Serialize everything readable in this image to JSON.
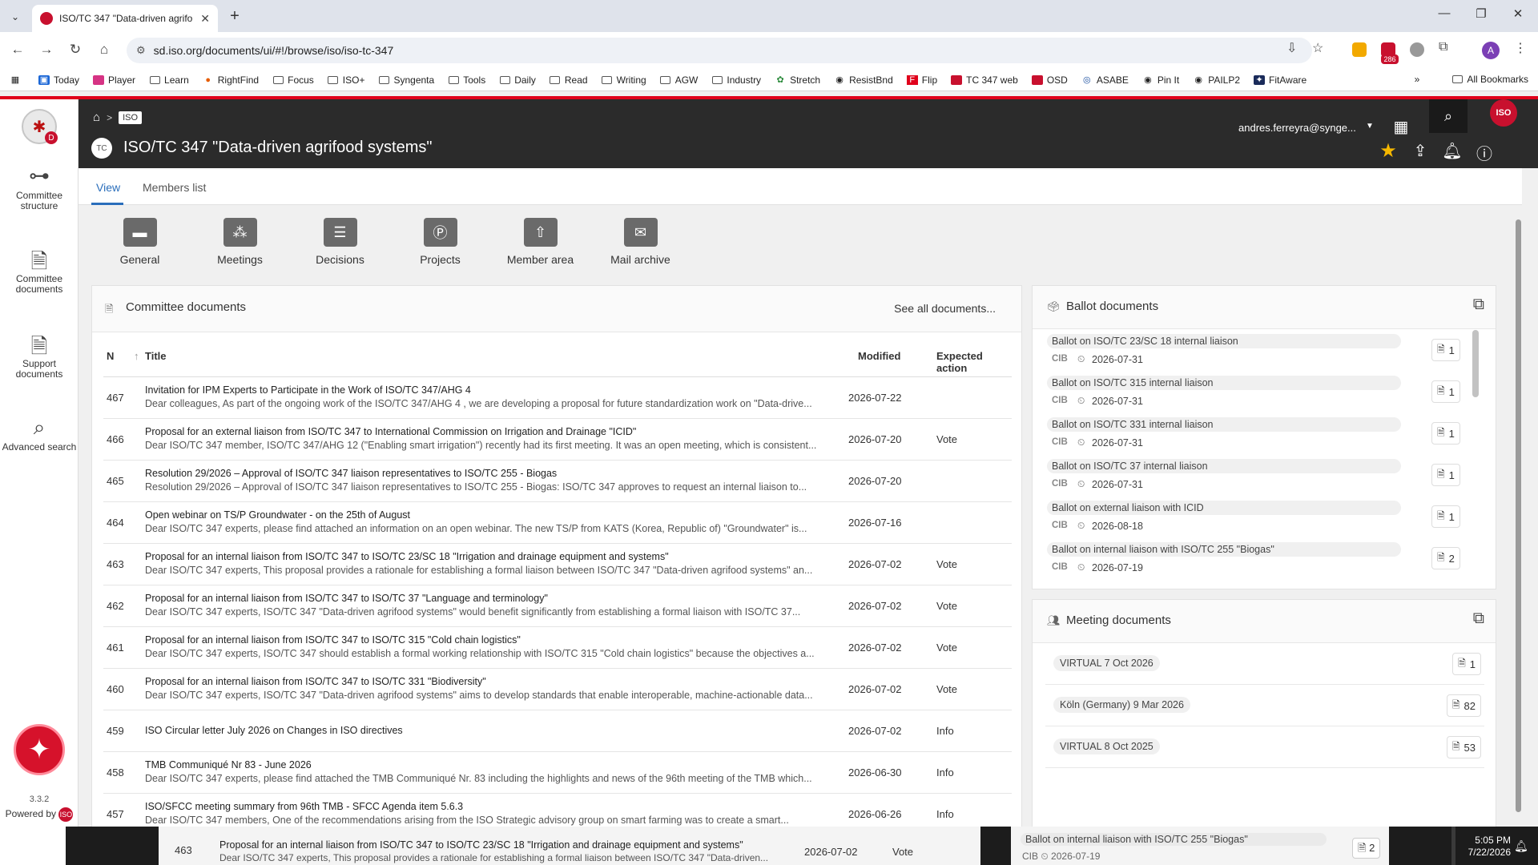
{
  "browser": {
    "tab_title": "ISO/TC 347 \"Data-driven agrifo",
    "url": "sd.iso.org/documents/ui/#!/browse/iso/iso-tc-347",
    "ext_badge": "286",
    "profile_initial": "A",
    "bookmarks": [
      "Today",
      "Player",
      "Learn",
      "RightFind",
      "Focus",
      "ISO+",
      "Syngenta",
      "Tools",
      "Daily",
      "Read",
      "Writing",
      "AGW",
      "Industry",
      "Stretch",
      "ResistBnd",
      "Flip",
      "TC 347 web",
      "OSD",
      "ASABE",
      "Pin It",
      "PAILP2",
      "FitAware"
    ],
    "all_bookmarks": "All Bookmarks"
  },
  "sidebar": {
    "logo_badge": "D",
    "items": [
      {
        "label": "Committee structure",
        "icon": "hierarchy-icon"
      },
      {
        "label": "Committee documents",
        "icon": "document-icon"
      },
      {
        "label": "Support documents",
        "icon": "document-icon"
      },
      {
        "label": "Advanced search",
        "icon": "search-icon"
      }
    ],
    "version": "3.3.2",
    "powered_by": "Powered by",
    "powered_logo": "ISO"
  },
  "header": {
    "breadcrumb_iso": "ISO",
    "tc_badge": "TC",
    "title": "ISO/TC 347 \"Data-driven agrifood systems\"",
    "user": "andres.ferreyra@synge...",
    "iso_logo": "ISO"
  },
  "subnav": {
    "tabs": [
      "View",
      "Members list"
    ],
    "active": "View"
  },
  "quicklinks": [
    "General",
    "Meetings",
    "Decisions",
    "Projects",
    "Member area",
    "Mail archive"
  ],
  "committee_documents": {
    "title": "Committee documents",
    "see_all": "See all documents...",
    "columns": {
      "n": "N",
      "title": "Title",
      "modified": "Modified",
      "action": "Expected action"
    },
    "rows": [
      {
        "n": "467",
        "title": "Invitation for IPM Experts to Participate in the Work of ISO/TC 347/AHG 4",
        "desc": "Dear colleagues, As part of the ongoing work of the ISO/TC 347/AHG 4 , we are developing a proposal for future standardization work on \"Data-drive...",
        "modified": "2026-07-22",
        "action": ""
      },
      {
        "n": "466",
        "title": "Proposal for an external liaison from ISO/TC 347 to International Commission on Irrigation and Drainage \"ICID\"",
        "desc": "Dear ISO/TC 347 member, ISO/TC 347/AHG 12 (\"Enabling smart irrigation\") recently had its first meeting. It was an open meeting, which is consistent...",
        "modified": "2026-07-20",
        "action": "Vote"
      },
      {
        "n": "465",
        "title": "Resolution 29/2026 – Approval of ISO/TC 347 liaison representatives to ISO/TC 255 - Biogas",
        "desc": "Resolution 29/2026 – Approval of ISO/TC 347 liaison representatives to ISO/TC 255 - Biogas: ISO/TC 347 approves to request an internal liaison to...",
        "modified": "2026-07-20",
        "action": ""
      },
      {
        "n": "464",
        "title": "Open webinar on TS/P Groundwater - on the 25th of August",
        "desc": "Dear ISO/TC 347 experts, please find attached an information on an open webinar. The new TS/P from KATS (Korea, Republic of) \"Groundwater\" is...",
        "modified": "2026-07-16",
        "action": ""
      },
      {
        "n": "463",
        "title": "Proposal for an internal liaison from ISO/TC 347 to ISO/TC 23/SC 18 \"Irrigation and drainage equipment and systems\"",
        "desc": "Dear ISO/TC 347 experts, This proposal provides a rationale for establishing a formal liaison between ISO/TC 347 \"Data-driven agrifood systems\" an...",
        "modified": "2026-07-02",
        "action": "Vote"
      },
      {
        "n": "462",
        "title": "Proposal for an internal liaison from ISO/TC 347 to ISO/TC 37 \"Language and terminology\"",
        "desc": "Dear ISO/TC 347 experts, ISO/TC 347 \"Data-driven agrifood systems\" would benefit significantly from establishing a formal liaison with ISO/TC 37...",
        "modified": "2026-07-02",
        "action": "Vote"
      },
      {
        "n": "461",
        "title": "Proposal for an internal liaison from ISO/TC 347 to ISO/TC 315 \"Cold chain logistics\"",
        "desc": "Dear ISO/TC 347 experts, ISO/TC 347 should establish a formal working relationship with ISO/TC 315 \"Cold chain logistics\" because the objectives a...",
        "modified": "2026-07-02",
        "action": "Vote"
      },
      {
        "n": "460",
        "title": "Proposal for an internal liaison from ISO/TC 347 to ISO/TC 331 \"Biodiversity\"",
        "desc": "Dear ISO/TC 347 experts, ISO/TC 347 \"Data-driven agrifood systems\" aims to develop standards that enable interoperable, machine-actionable data...",
        "modified": "2026-07-02",
        "action": "Vote"
      },
      {
        "n": "459",
        "title": "ISO Circular letter July 2026 on Changes in ISO directives",
        "desc": "",
        "modified": "2026-07-02",
        "action": "Info"
      },
      {
        "n": "458",
        "title": "TMB Communiqué Nr 83 - June 2026",
        "desc": "Dear ISO/TC 347 experts, please find attached the TMB Communiqué Nr. 83 including the highlights and news of the 96th meeting of the TMB which...",
        "modified": "2026-06-30",
        "action": "Info"
      },
      {
        "n": "457",
        "title": "ISO/SFCC meeting summary from 96th TMB - SFCC Agenda item 5.6.3",
        "desc": "Dear ISO/TC 347 members, One of the recommendations arising from the ISO Strategic advisory group on smart farming was to create a smart...",
        "modified": "2026-06-26",
        "action": "Info"
      }
    ]
  },
  "ballot_documents": {
    "title": "Ballot documents",
    "items": [
      {
        "title": "Ballot on ISO/TC 23/SC 18 internal liaison",
        "tag": "CIB",
        "date": "2026-07-31",
        "count": "1"
      },
      {
        "title": "Ballot on ISO/TC 315 internal liaison",
        "tag": "CIB",
        "date": "2026-07-31",
        "count": "1"
      },
      {
        "title": "Ballot on ISO/TC 331 internal liaison",
        "tag": "CIB",
        "date": "2026-07-31",
        "count": "1"
      },
      {
        "title": "Ballot on ISO/TC 37 internal liaison",
        "tag": "CIB",
        "date": "2026-07-31",
        "count": "1"
      },
      {
        "title": "Ballot on external liaison with ICID",
        "tag": "CIB",
        "date": "2026-08-18",
        "count": "1"
      },
      {
        "title": "Ballot on internal liaison with ISO/TC 255 \"Biogas\"",
        "tag": "CIB",
        "date": "2026-07-19",
        "count": "2"
      }
    ]
  },
  "meeting_documents": {
    "title": "Meeting documents",
    "items": [
      {
        "title": "VIRTUAL 7 Oct 2026",
        "count": "1"
      },
      {
        "title": "Köln (Germany) 9 Mar 2026",
        "count": "82"
      },
      {
        "title": "VIRTUAL 8 Oct 2025",
        "count": "53"
      }
    ]
  },
  "taskbar": {
    "preview": {
      "n": "463",
      "title": "Proposal for an internal liaison from ISO/TC 347 to ISO/TC 23/SC 18 \"Irrigation and drainage equipment and systems\"",
      "desc": "Dear ISO/TC 347 experts, This proposal provides a rationale for establishing a formal liaison between ISO/TC 347 \"Data-driven...",
      "modified": "2026-07-02",
      "action": "Vote"
    },
    "preview2": {
      "title": "Ballot on internal liaison with ISO/TC 255 \"Biogas\"",
      "tag": "CIB",
      "date": "2026-07-19",
      "count": "2"
    },
    "time": "5:05 PM",
    "date": "7/22/2026"
  }
}
